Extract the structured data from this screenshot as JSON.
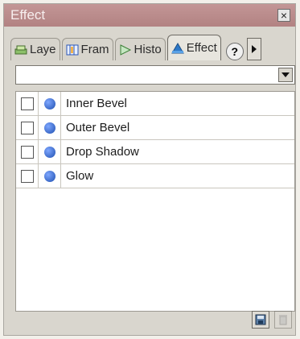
{
  "window": {
    "title": "Effect"
  },
  "tabs": [
    {
      "label": "Laye",
      "icon": "layers-icon"
    },
    {
      "label": "Fram",
      "icon": "frames-icon"
    },
    {
      "label": "Histo",
      "icon": "history-icon"
    },
    {
      "label": "Effect",
      "icon": "effect-icon"
    }
  ],
  "dropdown": {
    "value": ""
  },
  "effects": [
    {
      "label": "Inner Bevel",
      "checked": false
    },
    {
      "label": "Outer Bevel",
      "checked": false
    },
    {
      "label": "Drop Shadow",
      "checked": false
    },
    {
      "label": "Glow",
      "checked": false
    }
  ],
  "colors": {
    "titlebar": "#b98b8b",
    "panel": "#d9d6ce",
    "info_icon": "#1e4fb0"
  }
}
